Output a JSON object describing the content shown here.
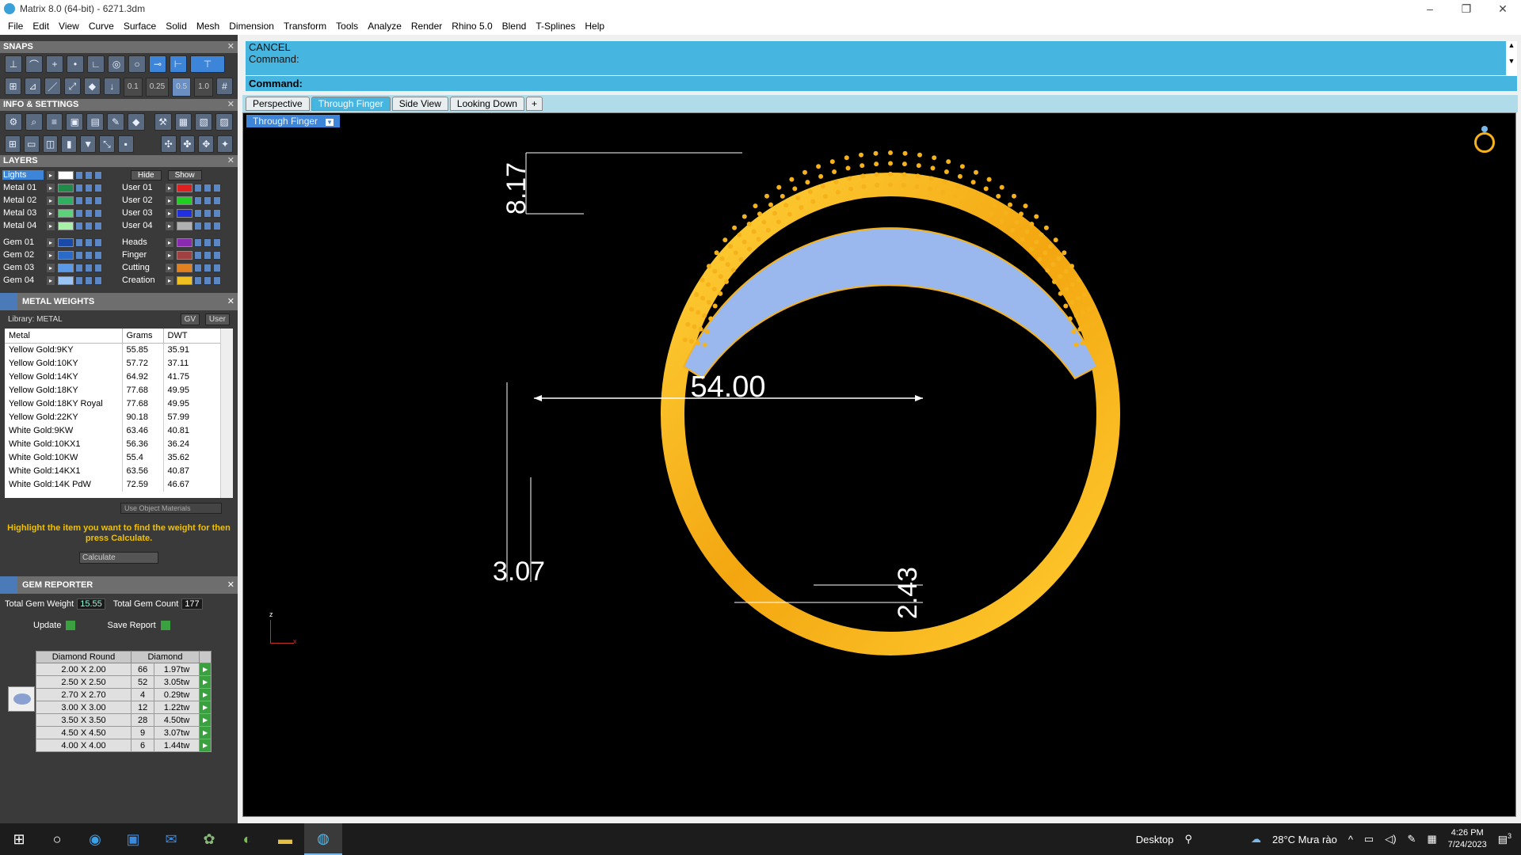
{
  "window": {
    "title": "Matrix 8.0 (64-bit) - 6271.3dm",
    "min": "–",
    "max": "❐",
    "close": "✕"
  },
  "menu": [
    "File",
    "Edit",
    "View",
    "Curve",
    "Surface",
    "Solid",
    "Mesh",
    "Dimension",
    "Transform",
    "Tools",
    "Analyze",
    "Render",
    "Rhino 5.0",
    "Blend",
    "T-Splines",
    "Help"
  ],
  "snaps": {
    "title": "SNAPS",
    "values": [
      "0.1",
      "0.25",
      "0.5",
      "1.0"
    ]
  },
  "info": {
    "title": "INFO & SETTINGS"
  },
  "layers": {
    "title": "LAYERS",
    "hide": "Hide",
    "show": "Show",
    "left": [
      {
        "name": "Lights",
        "color": "#ffffff",
        "selected": true
      },
      {
        "name": "Metal 01",
        "color": "#1f8a4a"
      },
      {
        "name": "Metal 02",
        "color": "#2fb060"
      },
      {
        "name": "Metal 03",
        "color": "#5ed27a"
      },
      {
        "name": "Metal 04",
        "color": "#a8f0a8"
      },
      {
        "name": "Gem 01",
        "color": "#1a4aa8"
      },
      {
        "name": "Gem 02",
        "color": "#2a6ac8"
      },
      {
        "name": "Gem 03",
        "color": "#5a9ae8"
      },
      {
        "name": "Gem 04",
        "color": "#9ac4f4"
      }
    ],
    "right": [
      {
        "name": "",
        "color": ""
      },
      {
        "name": "User 01",
        "color": "#e02020"
      },
      {
        "name": "User 02",
        "color": "#20d020"
      },
      {
        "name": "User 03",
        "color": "#2030e0"
      },
      {
        "name": "User 04",
        "color": "#b0b0b0"
      },
      {
        "name": "Heads",
        "color": "#8a2ab0"
      },
      {
        "name": "Finger",
        "color": "#a04040"
      },
      {
        "name": "Cutting",
        "color": "#e08020"
      },
      {
        "name": "Creation",
        "color": "#f0c020"
      }
    ]
  },
  "metal_weights": {
    "title": "METAL WEIGHTS",
    "library": "Library: METAL",
    "btn_gv": "GV",
    "btn_user": "User",
    "columns": [
      "Metal",
      "Grams",
      "DWT"
    ],
    "rows": [
      [
        "Yellow Gold:9KY",
        "55.85",
        "35.91"
      ],
      [
        "Yellow Gold:10KY",
        "57.72",
        "37.11"
      ],
      [
        "Yellow Gold:14KY",
        "64.92",
        "41.75"
      ],
      [
        "Yellow Gold:18KY",
        "77.68",
        "49.95"
      ],
      [
        "Yellow Gold:18KY Royal",
        "77.68",
        "49.95"
      ],
      [
        "Yellow Gold:22KY",
        "90.18",
        "57.99"
      ],
      [
        "White Gold:9KW",
        "63.46",
        "40.81"
      ],
      [
        "White Gold:10KX1",
        "56.36",
        "36.24"
      ],
      [
        "White Gold:10KW",
        "55.4",
        "35.62"
      ],
      [
        "White Gold:14KX1",
        "63.56",
        "40.87"
      ],
      [
        "White Gold:14K PdW",
        "72.59",
        "46.67"
      ]
    ],
    "use_object": "Use Object Materials",
    "hint": "Highlight the item you want to find the weight for then press Calculate.",
    "calculate": "Calculate"
  },
  "gem_reporter": {
    "title": "GEM REPORTER",
    "total_weight_label": "Total Gem Weight",
    "total_weight": "15.55",
    "total_count_label": "Total Gem Count",
    "total_count": "177",
    "update": "Update",
    "save_report": "Save Report",
    "columns": [
      "Diamond Round",
      "Diamond"
    ],
    "rows": [
      [
        "2.00 X 2.00",
        "66",
        "1.97tw"
      ],
      [
        "2.50 X 2.50",
        "52",
        "3.05tw"
      ],
      [
        "2.70 X 2.70",
        "4",
        "0.29tw"
      ],
      [
        "3.00 X 3.00",
        "12",
        "1.22tw"
      ],
      [
        "3.50 X 3.50",
        "28",
        "4.50tw"
      ],
      [
        "4.50 X 4.50",
        "9",
        "3.07tw"
      ],
      [
        "4.00 X 4.00",
        "6",
        "1.44tw"
      ]
    ]
  },
  "command": {
    "history": [
      "CANCEL",
      "Command:"
    ],
    "prompt": "Command:"
  },
  "tabs": [
    "Perspective",
    "Through Finger",
    "Side View",
    "Looking Down",
    "+"
  ],
  "active_tab": "Through Finger",
  "viewport": {
    "view_name": "Through Finger",
    "dims": {
      "top": "8.17",
      "diameter": "54.00",
      "thickness": "3.07",
      "bottom": "2.43"
    },
    "axis_z": "z",
    "axis_x": "x"
  },
  "colors": {
    "accent": "#46b6e0",
    "gold": "#f5b21a",
    "gem": "#9ab8ee"
  },
  "taskbar": {
    "desktop": "Desktop",
    "weather": "28°C  Mưa rào",
    "time": "4:26 PM",
    "date": "7/24/2023",
    "notif": "3"
  }
}
